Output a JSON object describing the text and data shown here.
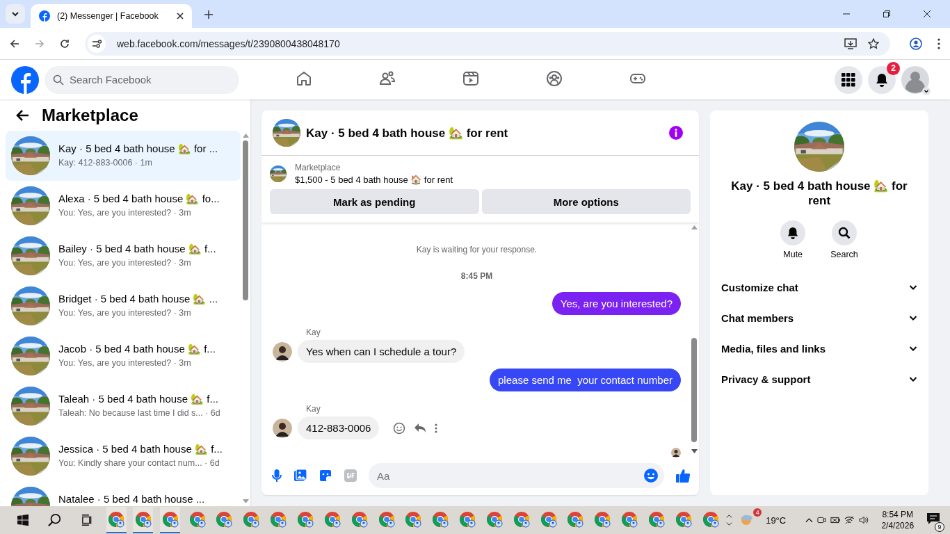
{
  "browser": {
    "tab_title": "(2) Messenger | Facebook",
    "url": "web.facebook.com/messages/t/2390800438048170"
  },
  "header": {
    "search_placeholder": "Search Facebook",
    "nav": [
      {
        "kind": "home",
        "selected": false
      },
      {
        "kind": "friends",
        "selected": false
      },
      {
        "kind": "video",
        "selected": false
      },
      {
        "kind": "groups",
        "selected": false
      },
      {
        "kind": "gaming",
        "selected": false
      }
    ],
    "notification_count": "2"
  },
  "sidebar": {
    "title": "Marketplace",
    "conversations": [
      {
        "title": "Kay · 5 bed 4 bath house 🏡 for ...",
        "subtitle": "Kay: 412-883-0006 · 1m",
        "selected": true
      },
      {
        "title": "Alexa · 5 bed 4 bath house 🏡 fo...",
        "subtitle": "You: Yes, are you interested? · 3m",
        "selected": false
      },
      {
        "title": "Bailey · 5 bed 4 bath house 🏡 f...",
        "subtitle": "You: Yes, are you interested? · 3m",
        "selected": false
      },
      {
        "title": "Bridget · 5 bed 4 bath house 🏡 ...",
        "subtitle": "You: Yes, are you interested? · 3m",
        "selected": false
      },
      {
        "title": "Jacob · 5 bed 4 bath house 🏡 f...",
        "subtitle": "You: Yes, are you interested? · 3m",
        "selected": false
      },
      {
        "title": "Taleah · 5 bed 4 bath house 🏡 f...",
        "subtitle": "Taleah: No because last time I did s... · 6d",
        "selected": false
      },
      {
        "title": "Jessica · 5 bed 4 bath house 🏡 f...",
        "subtitle": "You: Kindly share your contact num... · 6d",
        "selected": false
      },
      {
        "title": "Natalee · 5 bed 4 bath house ...",
        "selected": false
      }
    ]
  },
  "chat": {
    "title": "Kay · 5 bed 4 bath house 🏡 for rent",
    "listing": {
      "source": "Marketplace",
      "description": "$1,500 - 5 bed 4 bath house 🏠 for rent"
    },
    "actions": [
      "Mark as pending",
      "More options"
    ],
    "messages": [
      {
        "kind": "system",
        "text": "Kay is waiting for your response."
      },
      {
        "kind": "time",
        "text": "8:45 PM"
      },
      {
        "kind": "outgoing",
        "text": "Yes, are you interested?",
        "color": "#7b22f2"
      },
      {
        "kind": "incoming",
        "sender": "Kay",
        "text": "Yes when can I schedule a tour?"
      },
      {
        "kind": "outgoing",
        "text": "please send me  your contact number",
        "color": "#3847f5"
      },
      {
        "kind": "incoming",
        "sender": "Kay",
        "text": "412-883-0006",
        "hovered": true
      }
    ],
    "composer_placeholder": "Aa"
  },
  "details": {
    "title": "Kay · 5 bed 4 bath house 🏡 for rent",
    "actions": [
      {
        "kind": "mute",
        "label": "Mute"
      },
      {
        "kind": "search",
        "label": "Search"
      }
    ],
    "sections": [
      {
        "label": "Customize chat",
        "expanded": false
      },
      {
        "label": "Chat members",
        "expanded": false
      },
      {
        "label": "Media, files and links",
        "expanded": false
      },
      {
        "label": "Privacy & support",
        "expanded": false
      }
    ]
  },
  "taskbar": {
    "apps": [
      {
        "selected": true
      },
      {
        "selected": true
      },
      {
        "selected": true
      },
      {
        "selected": false
      },
      {
        "selected": false
      },
      {
        "selected": false
      },
      {
        "selected": false
      },
      {
        "selected": false
      },
      {
        "selected": false
      },
      {
        "selected": false
      },
      {
        "selected": false
      },
      {
        "selected": false
      },
      {
        "selected": false
      },
      {
        "selected": false
      },
      {
        "selected": false
      },
      {
        "selected": false
      },
      {
        "selected": false
      },
      {
        "selected": false
      },
      {
        "selected": false
      },
      {
        "selected": false
      },
      {
        "selected": false
      },
      {
        "selected": false
      },
      {
        "selected": false
      }
    ],
    "weather_badge": "4",
    "temperature": "19°C",
    "time": "8:54 PM",
    "date": "2/4/2026",
    "notification_count": "9"
  }
}
